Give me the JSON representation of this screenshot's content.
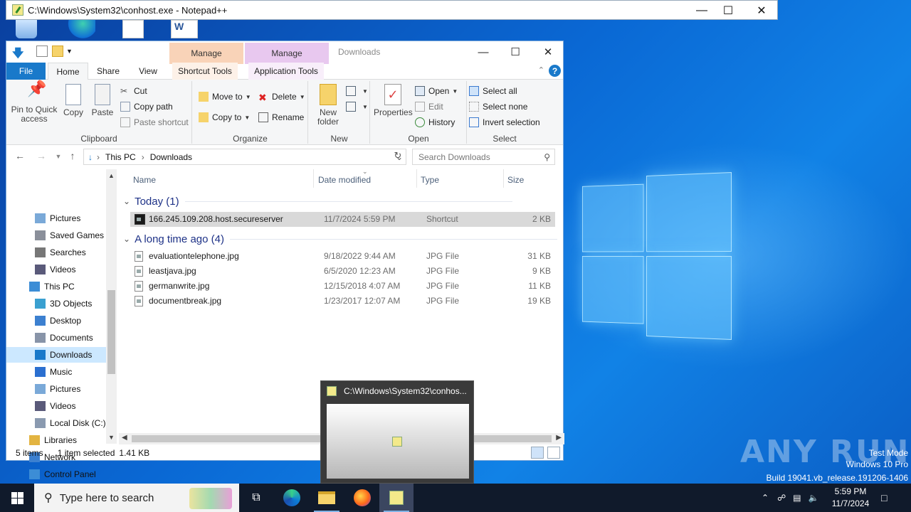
{
  "notepad": {
    "title": "C:\\Windows\\System32\\conhost.exe - Notepad++"
  },
  "explorer": {
    "title": "Downloads",
    "context_tabs": [
      {
        "label": "Manage",
        "sub": "Shortcut Tools"
      },
      {
        "label": "Manage",
        "sub": "Application Tools"
      }
    ],
    "tabs": [
      "File",
      "Home",
      "Share",
      "View"
    ],
    "ribbon": {
      "clipboard": {
        "label": "Clipboard",
        "pin": "Pin to Quick access",
        "copy": "Copy",
        "paste": "Paste",
        "cut": "Cut",
        "copy_path": "Copy path",
        "paste_shortcut": "Paste shortcut"
      },
      "organize": {
        "label": "Organize",
        "move_to": "Move to",
        "copy_to": "Copy to",
        "delete": "Delete",
        "rename": "Rename"
      },
      "new": {
        "label": "New",
        "new_folder": "New folder"
      },
      "open": {
        "label": "Open",
        "properties": "Properties",
        "open": "Open",
        "edit": "Edit",
        "history": "History"
      },
      "select": {
        "label": "Select",
        "select_all": "Select all",
        "select_none": "Select none",
        "invert": "Invert selection"
      }
    },
    "address": {
      "parts": [
        "This PC",
        "Downloads"
      ]
    },
    "search": {
      "placeholder": "Search Downloads"
    },
    "nav": [
      {
        "label": "Pictures"
      },
      {
        "label": "Saved Games"
      },
      {
        "label": "Searches"
      },
      {
        "label": "Videos"
      },
      {
        "label": "This PC"
      },
      {
        "label": "3D Objects"
      },
      {
        "label": "Desktop"
      },
      {
        "label": "Documents"
      },
      {
        "label": "Downloads"
      },
      {
        "label": "Music"
      },
      {
        "label": "Pictures"
      },
      {
        "label": "Videos"
      },
      {
        "label": "Local Disk (C:)"
      },
      {
        "label": "Libraries"
      },
      {
        "label": "Network"
      },
      {
        "label": "Control Panel"
      }
    ],
    "columns": {
      "name": "Name",
      "date": "Date modified",
      "type": "Type",
      "size": "Size"
    },
    "groups": [
      {
        "label": "Today (1)",
        "files": [
          {
            "name": "166.245.109.208.host.secureserver",
            "date": "11/7/2024 5:59 PM",
            "type": "Shortcut",
            "size": "2 KB"
          }
        ]
      },
      {
        "label": "A long time ago (4)",
        "files": [
          {
            "name": "evaluationtelephone.jpg",
            "date": "9/18/2022 9:44 AM",
            "type": "JPG File",
            "size": "31 KB"
          },
          {
            "name": "leastjava.jpg",
            "date": "6/5/2020 12:23 AM",
            "type": "JPG File",
            "size": "9 KB"
          },
          {
            "name": "germanwrite.jpg",
            "date": "12/15/2018 4:07 AM",
            "type": "JPG File",
            "size": "11 KB"
          },
          {
            "name": "documentbreak.jpg",
            "date": "1/23/2017 12:07 AM",
            "type": "JPG File",
            "size": "19 KB"
          }
        ]
      }
    ],
    "status": {
      "items": "5 items",
      "selected": "1 item selected",
      "size": "1.41 KB"
    }
  },
  "thumbnail": {
    "title": "C:\\Windows\\System32\\conhos..."
  },
  "taskbar": {
    "search_placeholder": "Type here to search",
    "time": "5:59 PM",
    "date": "11/7/2024"
  },
  "watermark": {
    "brand": "ANY RUN",
    "line1": "Test Mode",
    "line2": "Windows 10 Pro",
    "line3": "Build 19041.vb_release.191206-1406"
  },
  "colors": {
    "accent": "#1979ca",
    "selection": "#cce8ff",
    "taskbar": "#101a2b"
  }
}
